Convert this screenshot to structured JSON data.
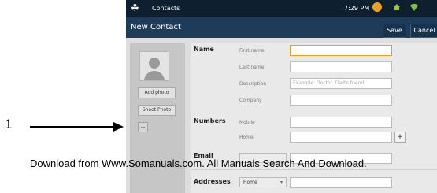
{
  "callout": {
    "number": "1"
  },
  "status_bar": {
    "app_label": "Contacts",
    "app_icon": "contacts-app-icon",
    "time": "7:29 PM",
    "icons": [
      "warning-icon",
      "home-icon",
      "wifi-icon"
    ]
  },
  "action_bar": {
    "title": "New Contact",
    "save_label": "Save",
    "cancel_label": "Cancel"
  },
  "photo_panel": {
    "avatar_icon": "person-placeholder-icon",
    "add_photo_label": "Add photo",
    "shoot_photo_label": "Shoot Photo",
    "small_add_label": "+"
  },
  "form": {
    "name_section": {
      "label": "Name",
      "fields": [
        {
          "label": "First name",
          "value": "",
          "placeholder": ""
        },
        {
          "label": "Last name",
          "value": "",
          "placeholder": ""
        },
        {
          "label": "Description",
          "value": "",
          "placeholder": "Example: Doctor, Dad's friend"
        },
        {
          "label": "Company",
          "value": "",
          "placeholder": ""
        }
      ]
    },
    "numbers_section": {
      "label": "Numbers",
      "fields": [
        {
          "label": "Mobile",
          "value": ""
        },
        {
          "label": "Home",
          "value": ""
        }
      ],
      "add_label": "+"
    },
    "email_section": {
      "label": "Email"
    },
    "addresses_section": {
      "label": "Addresses",
      "type_selected": "Home"
    }
  },
  "watermark": "Download from Www.Somanuals.com. All Manuals Search And Download."
}
